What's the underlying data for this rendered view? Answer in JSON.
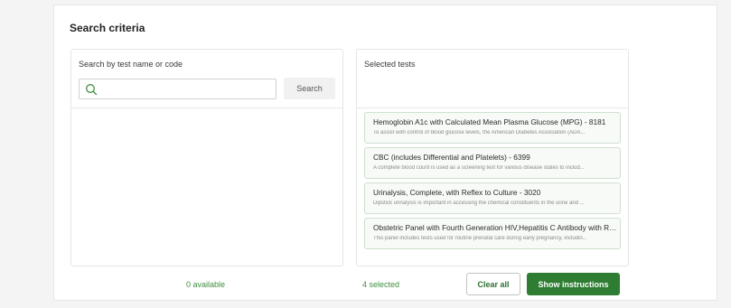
{
  "section_title": "Search criteria",
  "search_panel": {
    "label": "Search by test name or code",
    "input_value": "",
    "input_placeholder": "",
    "search_button_label": "Search"
  },
  "selected_panel": {
    "label": "Selected tests",
    "tests": [
      {
        "name": "Hemoglobin A1c with Calculated Mean Plasma Glucose (MPG) - 8181",
        "description": "To assist with control of blood glucose levels, the American Diabetes Association (ADA..."
      },
      {
        "name": "CBC (includes Differential and Platelets) - 6399",
        "description": "A complete blood count is used as a screening test for various disease states to includ..."
      },
      {
        "name": "Urinalysis, Complete, with Reflex to Culture - 3020",
        "description": "Dipstick urinalysis is important in accessing the chemical constituents in the urine and ..."
      },
      {
        "name": "Obstetric Panel with Fourth Generation HIV,Hepatitis C Antibody with Refle...",
        "description": "This panel includes tests used for routine prenatal care during early pregnancy, includin..."
      }
    ]
  },
  "footer": {
    "available_text": "0 available",
    "selected_text": "4 selected",
    "clear_all_label": "Clear all",
    "show_instructions_label": "Show instructions"
  },
  "colors": {
    "accent": "#2e7d32",
    "accent_text": "#3f8f3f",
    "card_border": "#cfe0cf"
  }
}
